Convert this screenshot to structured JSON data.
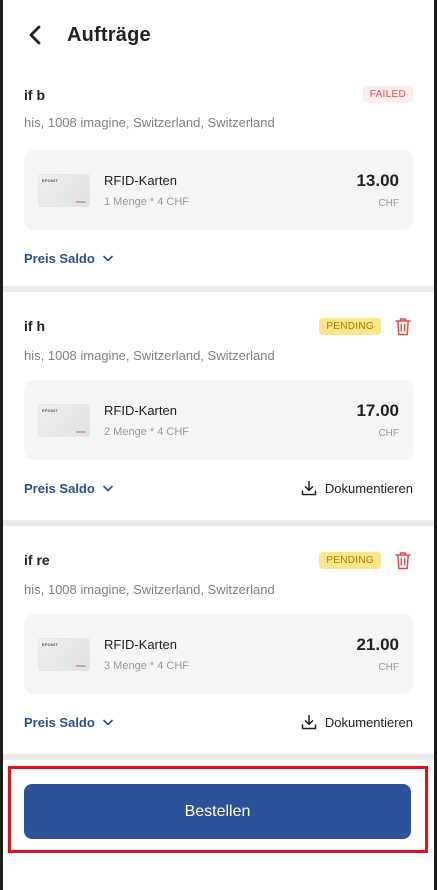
{
  "header": {
    "title": "Aufträge",
    "back_icon": "chevron-left-icon"
  },
  "orders": [
    {
      "name": "if b",
      "status": "FAILED",
      "address": "his, 1008 imagine, Switzerland, Switzerland",
      "item": {
        "name": "RFID-Karten",
        "quantity": "1 Menge * 4 CHF",
        "price": "13.00",
        "currency": "CHF",
        "thumb_logo": "EFONIT"
      },
      "balance_label": "Preis Saldo",
      "document_label": ""
    },
    {
      "name": "if h",
      "status": "PENDING",
      "address": "his, 1008 imagine, Switzerland, Switzerland",
      "item": {
        "name": "RFID-Karten",
        "quantity": "2 Menge * 4 CHF",
        "price": "17.00",
        "currency": "CHF",
        "thumb_logo": "EFONIT"
      },
      "balance_label": "Preis Saldo",
      "document_label": "Dokumentieren"
    },
    {
      "name": "if re",
      "status": "PENDING",
      "address": "his, 1008 imagine, Switzerland, Switzerland",
      "item": {
        "name": "RFID-Karten",
        "quantity": "3 Menge * 4 CHF",
        "price": "21.00",
        "currency": "CHF",
        "thumb_logo": "EFONIT"
      },
      "balance_label": "Preis Saldo",
      "document_label": "Dokumentieren"
    }
  ],
  "footer": {
    "button_label": "Bestellen"
  },
  "colors": {
    "primary": "#2c5299",
    "failed_text": "#e24a4a",
    "failed_bg": "#fdeeee",
    "pending_text": "#b07a00",
    "pending_bg": "#fde68a",
    "highlight": "#e0101a"
  }
}
